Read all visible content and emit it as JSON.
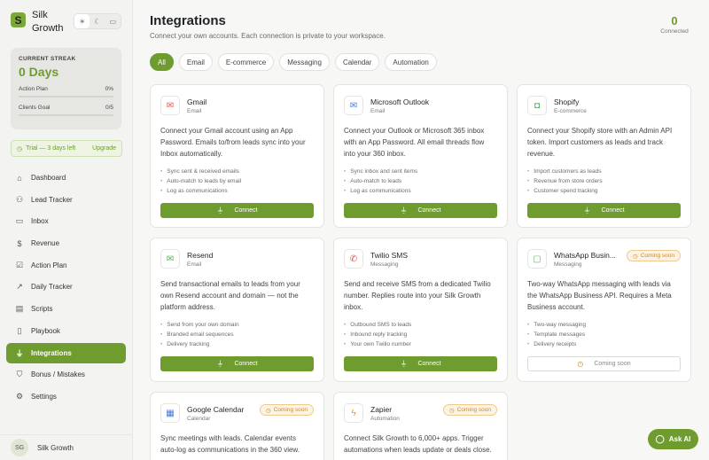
{
  "app": {
    "name_line1": "Silk",
    "name_line2": "Growth",
    "logo_letter": "S"
  },
  "theme_icons": [
    "sun-icon",
    "moon-icon",
    "monitor-icon"
  ],
  "streak": {
    "label": "CURRENT STREAK",
    "days": "0 Days",
    "goals": [
      {
        "label": "Action Plan",
        "value": "0%"
      },
      {
        "label": "Clients Goal",
        "value": "0/5"
      }
    ]
  },
  "trial": {
    "text": "Trial — 3 days left",
    "upgrade": "Upgrade"
  },
  "nav": [
    {
      "label": "Dashboard",
      "icon": "home-icon"
    },
    {
      "label": "Lead Tracker",
      "icon": "users-icon"
    },
    {
      "label": "Inbox",
      "icon": "inbox-icon"
    },
    {
      "label": "Revenue",
      "icon": "dollar-icon"
    },
    {
      "label": "Action Plan",
      "icon": "checkbox-icon"
    },
    {
      "label": "Daily Tracker",
      "icon": "trend-icon"
    },
    {
      "label": "Scripts",
      "icon": "chat-icon"
    },
    {
      "label": "Playbook",
      "icon": "book-icon"
    },
    {
      "label": "Integrations",
      "icon": "plug-icon",
      "active": true
    },
    {
      "label": "Bonus / Mistakes",
      "icon": "shield-icon"
    },
    {
      "label": "Settings",
      "icon": "gear-icon"
    }
  ],
  "user": {
    "initials": "SG",
    "name": "Silk Growth"
  },
  "header": {
    "title": "Integrations",
    "subtitle": "Connect your own accounts. Each connection is private to your workspace.",
    "connected_count": "0",
    "connected_label": "Connected"
  },
  "filters": [
    "All",
    "Email",
    "E-commerce",
    "Messaging",
    "Calendar",
    "Automation"
  ],
  "cards": [
    {
      "name": "Gmail",
      "category": "Email",
      "icon": "mail-icon",
      "description": "Connect your Gmail account using an App Password. Emails to/from leads sync into your Inbox automatically.",
      "features": [
        "Sync sent & received emails",
        "Auto-match to leads by email",
        "Log as communications"
      ],
      "button": "Connect"
    },
    {
      "name": "Microsoft Outlook",
      "category": "Email",
      "icon": "mail-icon",
      "description": "Connect your Outlook or Microsoft 365 inbox with an App Password. All email threads flow into your 360 inbox.",
      "features": [
        "Sync inbox and sent items",
        "Auto-match to leads",
        "Log as communications"
      ],
      "button": "Connect"
    },
    {
      "name": "Shopify",
      "category": "E-commerce",
      "icon": "shopping-bag-icon",
      "description": "Connect your Shopify store with an Admin API token. Import customers as leads and track revenue.",
      "features": [
        "Import customers as leads",
        "Revenue from store orders",
        "Customer spend tracking"
      ],
      "button": "Connect"
    },
    {
      "name": "Resend",
      "category": "Email",
      "icon": "mail-icon",
      "description": "Send transactional emails to leads from your own Resend account and domain — not the platform address.",
      "features": [
        "Send from your own domain",
        "Branded email sequences",
        "Delivery tracking"
      ],
      "button": "Connect"
    },
    {
      "name": "Twilio SMS",
      "category": "Messaging",
      "icon": "phone-icon",
      "description": "Send and receive SMS from a dedicated Twilio number. Replies route into your Silk Growth inbox.",
      "features": [
        "Outbound SMS to leads",
        "Inbound reply tracking",
        "Your own Twilio number"
      ],
      "button": "Connect"
    },
    {
      "name": "WhatsApp Busin...",
      "category": "Messaging",
      "icon": "message-icon",
      "badge": "Coming soon",
      "description": "Two-way WhatsApp messaging with leads via the WhatsApp Business API. Requires a Meta Business account.",
      "features": [
        "Two-way messaging",
        "Template messages",
        "Delivery receipts"
      ],
      "button": "Coming soon"
    },
    {
      "name": "Google Calendar",
      "category": "Calendar",
      "icon": "calendar-icon",
      "badge": "Coming soon",
      "description": "Sync meetings with leads. Calendar events auto-log as communications in the 360 view.",
      "features": [],
      "button": ""
    },
    {
      "name": "Zapier",
      "category": "Automation",
      "icon": "zap-icon",
      "badge": "Coming soon",
      "description": "Connect Silk Growth to 6,000+ apps. Trigger automations when leads update or deals close.",
      "features": [],
      "button": ""
    }
  ],
  "ask_ai": "Ask AI",
  "colors": {
    "accent": "#6f9c2f",
    "badge": "#c88a2a",
    "gmail": "#d9534f",
    "outlook": "#3b7bd9"
  }
}
